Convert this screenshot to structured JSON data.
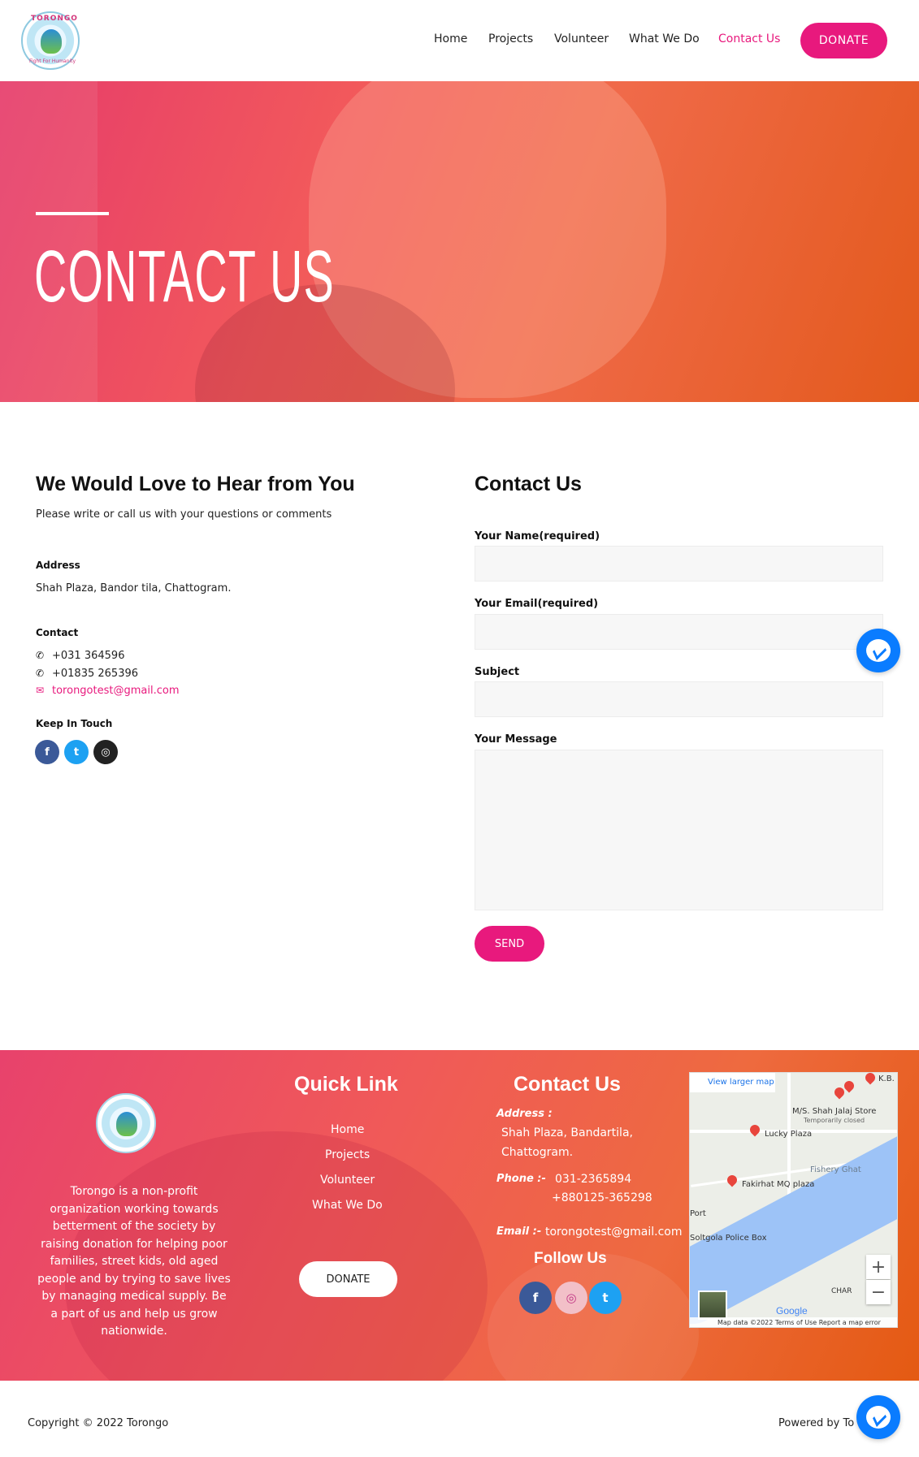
{
  "nav": {
    "logo_top": "TORONGO",
    "logo_bottom": "Fight For Humanity",
    "items": [
      {
        "label": "Home"
      },
      {
        "label": "Projects"
      },
      {
        "label": "Volunteer"
      },
      {
        "label": "What We Do"
      },
      {
        "label": "Contact Us",
        "active": true
      }
    ],
    "donate": "DONATE",
    "accent_color": "#e8197d"
  },
  "hero": {
    "title": "CONTACT US"
  },
  "info": {
    "heading": "We Would Love to Hear from You",
    "subtitle": "Please write or call us with your questions or comments",
    "address_label": "Address",
    "address": "Shah Plaza, Bandor tila, Chattogram.",
    "contact_label": "Contact",
    "phone1": "+031 364596",
    "phone2": "+01835 265396",
    "email": "torongotest@gmail.com",
    "keep_label": "Keep In Touch",
    "social": [
      "facebook-icon",
      "twitter-icon",
      "instagram-icon"
    ]
  },
  "form": {
    "heading": "Contact Us",
    "name_label": "Your Name(required)",
    "email_label": "Your Email(required)",
    "subject_label": "Subject",
    "message_label": "Your Message",
    "send": "SEND"
  },
  "footer": {
    "about": "Torongo is a non-profit organization working towards betterment of the society by raising donation for helping poor families, street kids, old aged people and by trying to save lives by managing medical supply. Be a part of us and help us grow nationwide.",
    "quick_heading": "Quick Link",
    "links": [
      "Home",
      "Projects",
      "Volunteer",
      "What We Do"
    ],
    "donate": "DONATE",
    "contact_heading": "Contact Us",
    "address_label": "Address :",
    "address_line1": "Shah Plaza, Bandartila,",
    "address_line2": "Chattogram.",
    "phone_label": "Phone :-",
    "phone1": "031-2365894",
    "phone2": "+880125-365298",
    "email_label": "Email :-",
    "email": "torongotest@gmail.com",
    "follow_heading": "Follow Us",
    "follow_icons": [
      "facebook-icon",
      "instagram-icon",
      "twitter-icon"
    ]
  },
  "map": {
    "view_larger": "View larger map",
    "labels": [
      "K.B.",
      "M/S. Shah Jalaj Store",
      "Temporarily closed",
      "Lucky Plaza",
      "Fishery Ghat",
      "Fakirhat MQ plaza",
      "Port",
      "Soltgola Police Box",
      "CHAR"
    ],
    "attribution": "Map data ©2022   Terms of Use   Report a map error",
    "google": "Google"
  },
  "bottom": {
    "copyright": "Copyright © 2022 Torongo",
    "powered": "Powered by To"
  }
}
